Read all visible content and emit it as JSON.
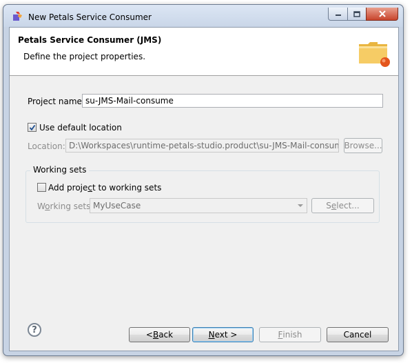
{
  "window": {
    "title": "New Petals Service Consumer",
    "icon": "petals-app-icon"
  },
  "header": {
    "title": "Petals Service Consumer (JMS)",
    "subtitle": "Define the project properties.",
    "icon": "folder-wizard-icon"
  },
  "project": {
    "name_label": "Project name:",
    "name_value": "su-JMS-Mail-consume",
    "default_location_label": "Use default location",
    "default_location_checked": true,
    "location_label": "Location:",
    "location_value": "D:\\Workspaces\\runtime-petals-studio.product\\su-JMS-Mail-consume",
    "browse_label": "Browse..."
  },
  "working_sets": {
    "group_title": "Working sets",
    "add_label_pre": "Add proje",
    "add_label_mnemonic": "c",
    "add_label_post": "t to working sets",
    "add_checked": false,
    "sets_label_pre": "W",
    "sets_label_mnemonic": "o",
    "sets_label_post": "rking sets:",
    "selected_value": "MyUseCase",
    "select_pre": "S",
    "select_mnemonic": "e",
    "select_post": "lect..."
  },
  "footer": {
    "back_pre": "< ",
    "back_mnemonic": "B",
    "back_post": "ack",
    "next_mnemonic": "N",
    "next_post": "ext >",
    "finish_mnemonic": "F",
    "finish_post": "inish",
    "cancel_label": "Cancel",
    "help_glyph": "?"
  }
}
